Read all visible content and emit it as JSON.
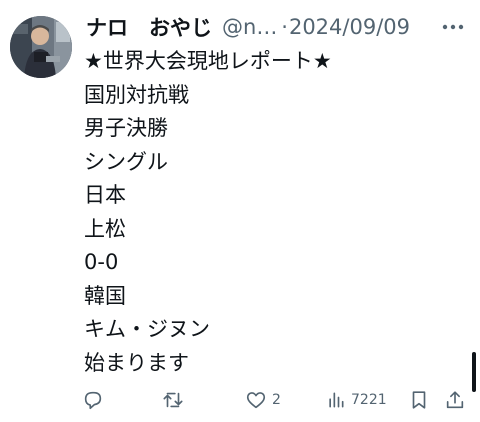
{
  "post": {
    "display_name": "ナロ　おやじ",
    "handle": "@narooyaji",
    "separator": "·",
    "date": "2024/09/09",
    "lines": [
      "★世界大会現地レポート★",
      "国別対抗戦",
      "男子決勝",
      "シングル",
      "日本",
      "上松",
      "0-0",
      "韓国",
      "キム・ジヌン",
      "始まります"
    ]
  },
  "actions": {
    "reply_icon": "reply-icon",
    "retweet_icon": "retweet-icon",
    "like_icon": "heart-icon",
    "like_count": "2",
    "views_icon": "views-chart-icon",
    "views_count": "7221",
    "bookmark_icon": "bookmark-icon",
    "share_icon": "share-icon"
  },
  "colors": {
    "text": "#0f1419",
    "secondary": "#536471",
    "background": "#ffffff"
  }
}
